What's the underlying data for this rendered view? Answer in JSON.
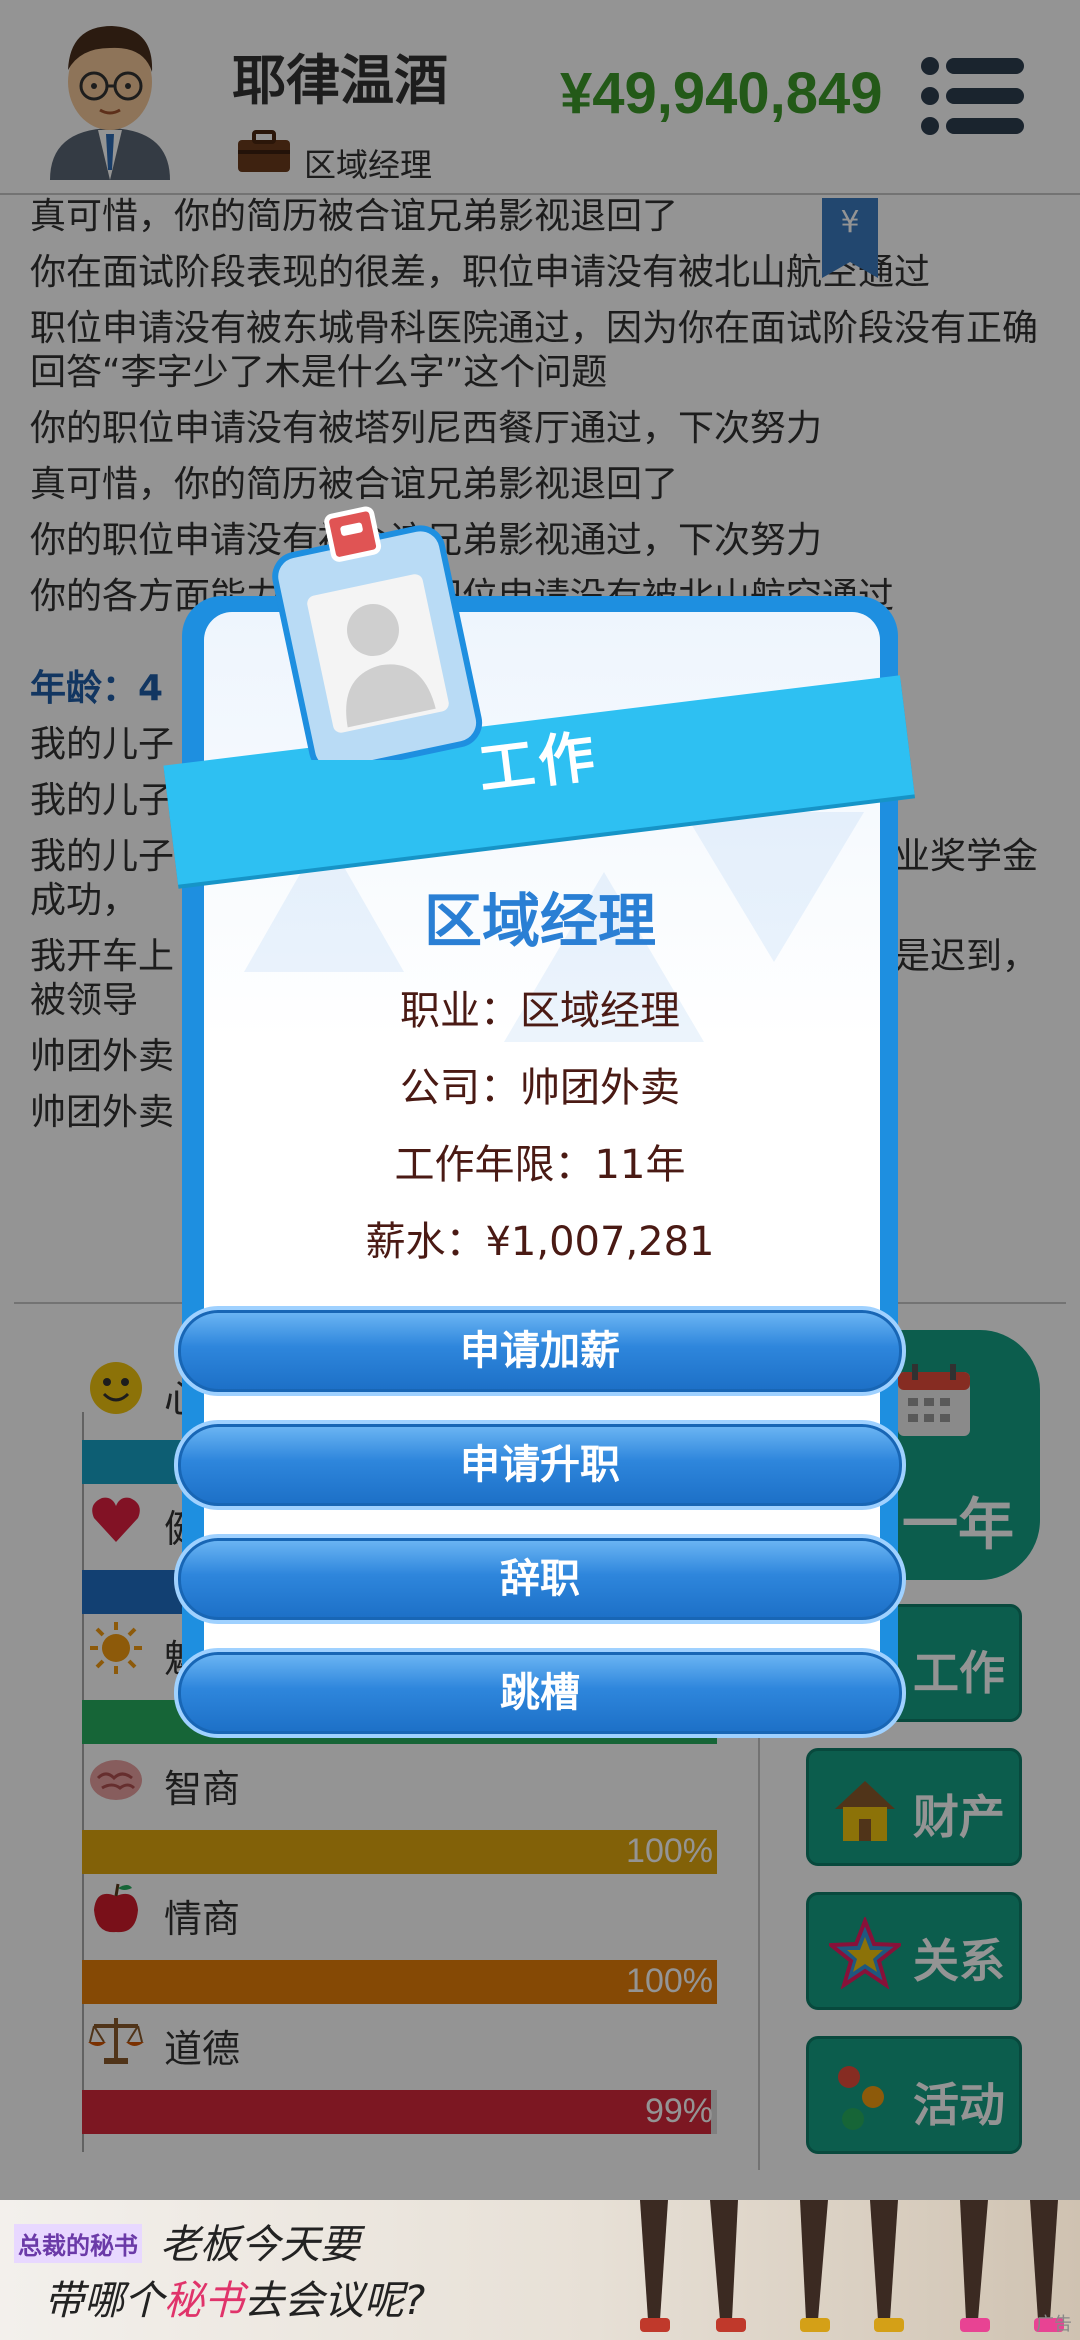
{
  "header": {
    "player_name": "耶律温酒",
    "job_title": "区域经理",
    "money": "¥49,940,849"
  },
  "log": {
    "lines": [
      "真可惜，你的简历被合谊兄弟影视退回了",
      "你在面试阶段表现的很差，职位申请没有被北山航空通过",
      "职位申请没有被东城骨科医院通过，因为你在面试阶段没有正确回答“李字少了木是什么字”这个问题",
      "你的职位申请没有被塔列尼西餐厅通过，下次努力",
      "真可惜，你的简历被合谊兄弟影视退回了",
      "你的职位申请没有被合谊兄弟影视通过，下次努力",
      "你的各方面能力不满足，职位申请没有被北山航空通过"
    ],
    "age_line": "年龄：4",
    "lines2": [
      "我的儿子",
      "我的儿子",
      "我的儿子　　　　　　　　　　　　　　　　　　　专业奖学金成功，",
      "我开车上　　　　　　　　　　　　　　　　　　　还是迟到，被领导",
      "帅团外卖",
      "帅团外卖"
    ],
    "bookmark": "¥"
  },
  "stats": [
    {
      "label": "心",
      "percent": "",
      "value": 100,
      "color": "#17a2c6",
      "icon": "smiley-icon"
    },
    {
      "label": "健",
      "percent": "",
      "value": 100,
      "color": "#1f6fc4",
      "icon": "heart-icon"
    },
    {
      "label": "魅",
      "percent": "",
      "value": 100,
      "color": "#27ae60",
      "icon": "sun-icon"
    },
    {
      "label": "智商",
      "percent": "100%",
      "value": 100,
      "color": "#e0a80e",
      "icon": "brain-icon"
    },
    {
      "label": "情商",
      "percent": "100%",
      "value": 100,
      "color": "#e67e0a",
      "icon": "apple-icon"
    },
    {
      "label": "道德",
      "percent": "99%",
      "value": 99,
      "color": "#d6283b",
      "icon": "scales-icon"
    }
  ],
  "side": {
    "year_label": "一年",
    "buttons": [
      {
        "label": "工作",
        "icon": "briefcase-icon"
      },
      {
        "label": "财产",
        "icon": "house-icon"
      },
      {
        "label": "关系",
        "icon": "star-icon"
      },
      {
        "label": "活动",
        "icon": "dots-icon"
      }
    ]
  },
  "modal": {
    "header": "工作",
    "title": "区域经理",
    "occupation": "职业：区域经理",
    "company": "公司：帅团外卖",
    "years": "工作年限：11年",
    "salary": "薪水：¥1,007,281",
    "buttons": [
      "申请加薪",
      "申请升职",
      "辞职",
      "跳槽"
    ]
  },
  "ad": {
    "line1": "老板今天要",
    "line2a": "带哪个",
    "line2b": "秘书",
    "line2c": "去会议呢?",
    "tag": "广告"
  }
}
